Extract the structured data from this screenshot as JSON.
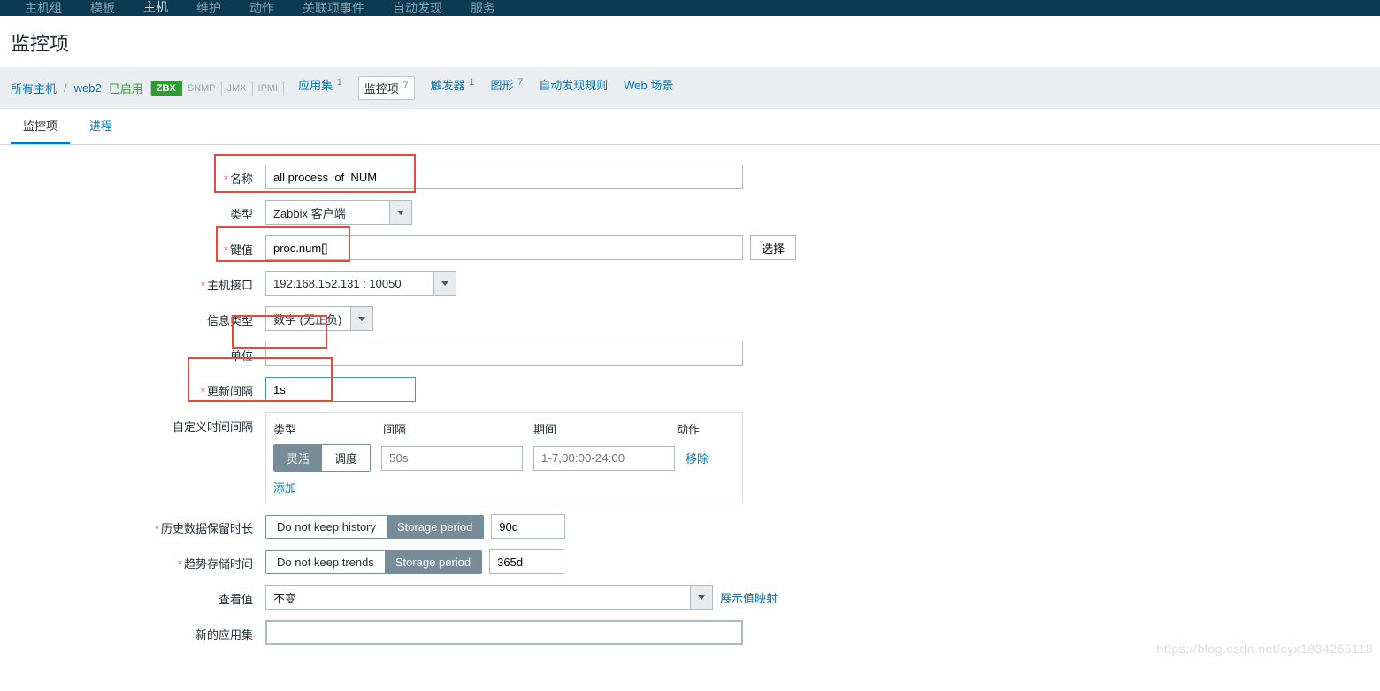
{
  "topnav": {
    "items": [
      "主机组",
      "模板",
      "主机",
      "维护",
      "动作",
      "关联项事件",
      "自动发现",
      "服务"
    ],
    "activeIndex": 2
  },
  "page": {
    "title": "监控项"
  },
  "hostbar": {
    "all_hosts": "所有主机",
    "host": "web2",
    "status": "已启用",
    "badges": [
      "ZBX",
      "SNMP",
      "JMX",
      "IPMI"
    ],
    "links": [
      {
        "label": "应用集",
        "count": "1"
      },
      {
        "label": "监控项",
        "count": "7",
        "current": true
      },
      {
        "label": "触发器",
        "count": "1"
      },
      {
        "label": "图形",
        "count": "7"
      },
      {
        "label": "自动发现规则",
        "count": ""
      },
      {
        "label": "Web 场景",
        "count": ""
      }
    ]
  },
  "subtabs": {
    "items": [
      "监控项",
      "进程"
    ],
    "activeIndex": 0
  },
  "form": {
    "name": {
      "label": "名称",
      "value": "all process  of  NUM",
      "required": true
    },
    "type": {
      "label": "类型",
      "value": "Zabbix 客户端"
    },
    "key": {
      "label": "键值",
      "value": "proc.num[]",
      "required": true,
      "pick": "选择"
    },
    "iface": {
      "label": "主机接口",
      "value": "192.168.152.131 : 10050",
      "required": true
    },
    "info": {
      "label": "信息类型",
      "value": "数字 (无正负)"
    },
    "unit": {
      "label": "单位",
      "value": ""
    },
    "interval": {
      "label": "更新间隔",
      "value": "1s",
      "required": true
    },
    "custom": {
      "label": "自定义时间间隔",
      "head": {
        "type": "类型",
        "interval": "间隔",
        "period": "期间",
        "action": "动作"
      },
      "seg": {
        "a": "灵活",
        "b": "调度"
      },
      "int_ph": "50s",
      "per_ph": "1-7,00:00-24:00",
      "remove": "移除",
      "add": "添加"
    },
    "history": {
      "label": "历史数据保留时长",
      "required": true,
      "a": "Do not keep history",
      "b": "Storage period",
      "val": "90d"
    },
    "trend": {
      "label": "趋势存储时间",
      "required": true,
      "a": "Do not keep trends",
      "b": "Storage period",
      "val": "365d"
    },
    "showval": {
      "label": "查看值",
      "value": "不变",
      "link": "展示值映射"
    },
    "newapp": {
      "label": "新的应用集",
      "value": ""
    }
  },
  "watermark": "https://blog.csdn.net/cyx1834265118"
}
